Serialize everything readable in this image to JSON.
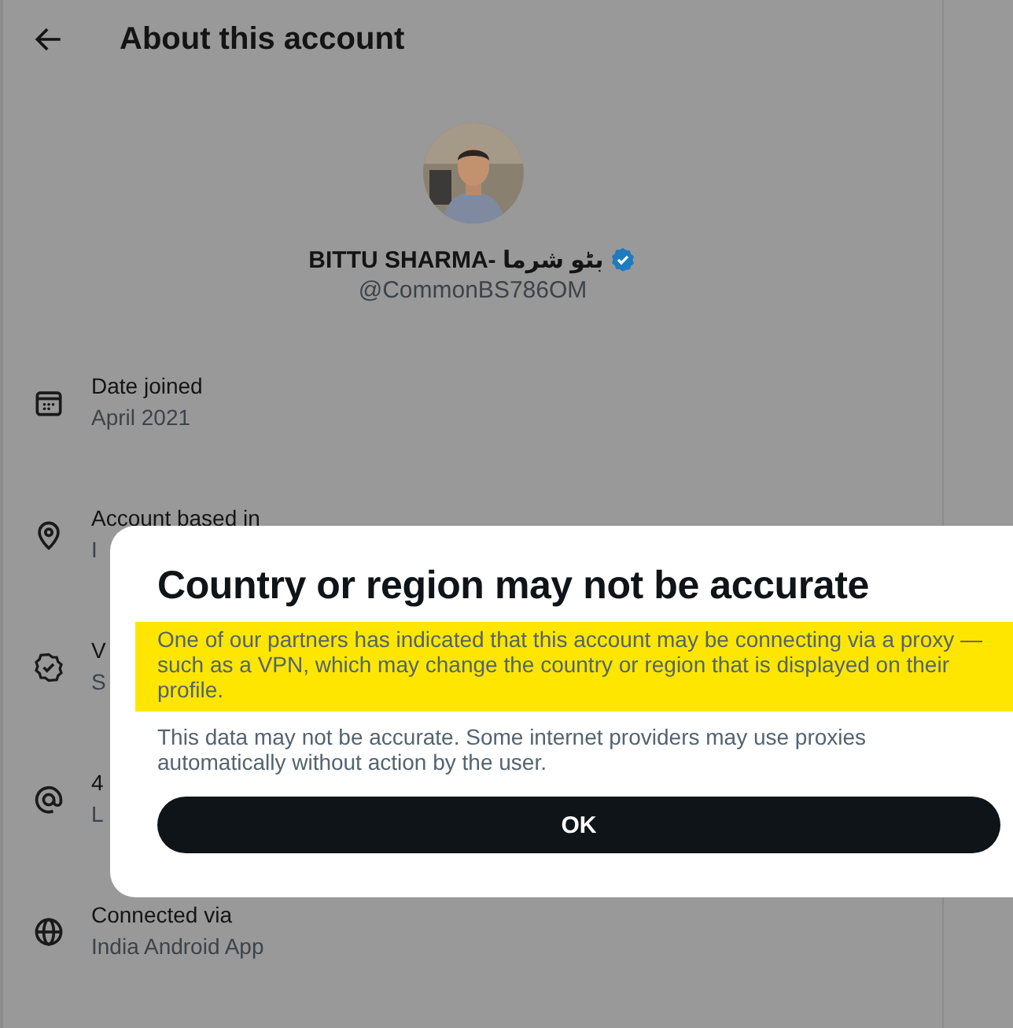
{
  "header": {
    "title": "About this account"
  },
  "profile": {
    "name": "BITTU SHARMA- بٹو شرما",
    "verified": true,
    "handle": "@CommonBS786OM"
  },
  "details": [
    {
      "kind": "date",
      "label": "Date joined",
      "value": "April 2021"
    },
    {
      "kind": "location",
      "label": "Account based in",
      "value": "I"
    },
    {
      "kind": "verified",
      "label": "V",
      "value": "S"
    },
    {
      "kind": "at",
      "label": "4",
      "value": "L"
    },
    {
      "kind": "globe",
      "label": "Connected via",
      "value": "India Android App"
    }
  ],
  "dialog": {
    "title": "Country or region may not be accurate",
    "highlighted_text": "One of our partners has indicated that this account may be connecting via a proxy — such as a VPN, which may change the country or region that is displayed on their profile.",
    "note": "This data may not be accurate. Some internet providers may use proxies automatically without action by the user.",
    "button": "OK"
  }
}
